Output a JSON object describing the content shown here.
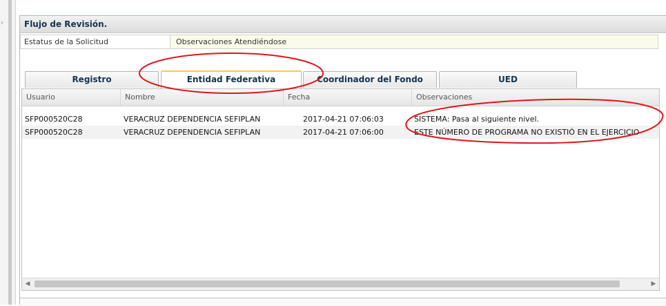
{
  "panel": {
    "title": "Flujo de Revisión.",
    "status_label": "Estatus de la Solicitud",
    "status_value": "Observaciones Atendiéndose"
  },
  "tabs": [
    {
      "label": "Registro",
      "active": false
    },
    {
      "label": "Entidad Federativa",
      "active": true
    },
    {
      "label": "Coordinador del Fondo",
      "active": false
    },
    {
      "label": "UED",
      "active": false
    }
  ],
  "grid": {
    "columns": [
      "Usuario",
      "Nombre",
      "Fecha",
      "Observaciones"
    ],
    "rows": [
      {
        "usuario": "SFP000520C28",
        "nombre": "VERACRUZ DEPENDENCIA SEFIPLAN",
        "fecha": "2017-04-21 07:06:03",
        "observaciones": "SISTEMA: Pasa al siguiente nivel."
      },
      {
        "usuario": "SFP000520C28",
        "nombre": "VERACRUZ DEPENDENCIA SEFIPLAN",
        "fecha": "2017-04-21 07:06:00",
        "observaciones": "ESTE NÚMERO DE PROGRAMA NO EXISTIÓ EN EL EJERCICIO"
      }
    ]
  },
  "scrollbar": {
    "left_arrow": "◀",
    "right_arrow": "▶"
  },
  "colors": {
    "annotation": "#e0141a",
    "active_tab_accent": "#ffc845",
    "header_text": "#15334f"
  }
}
